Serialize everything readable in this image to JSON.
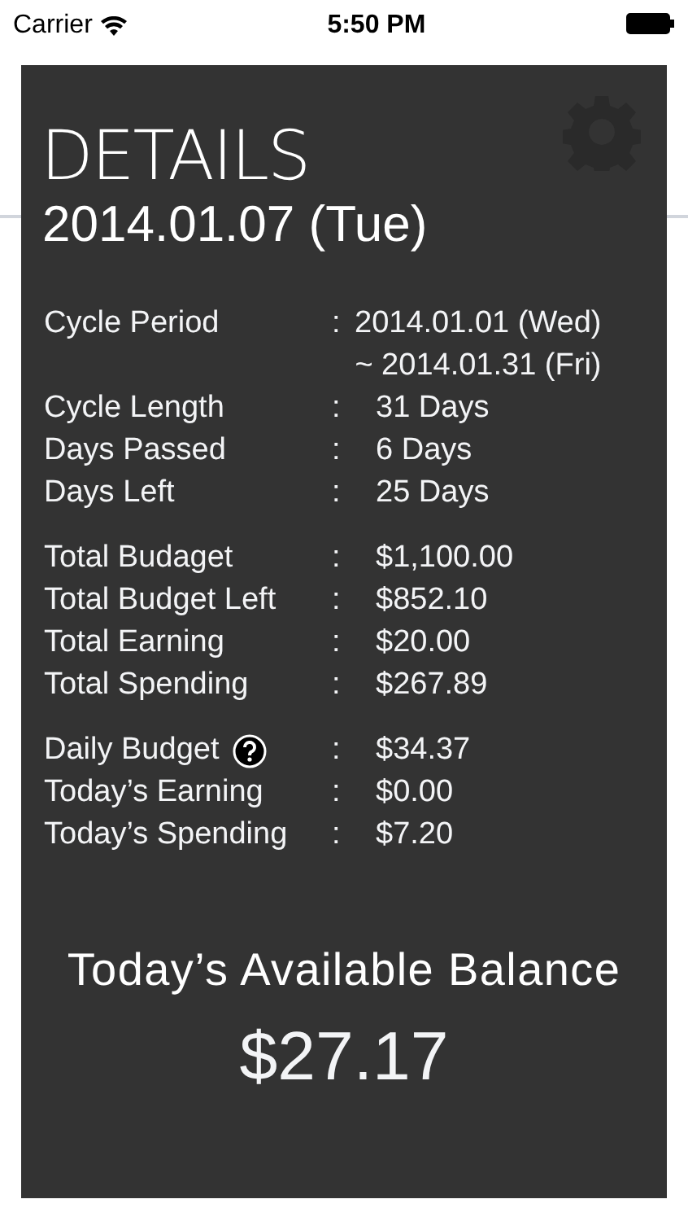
{
  "status_bar": {
    "carrier": "Carrier",
    "time": "5:50 PM"
  },
  "details": {
    "title": "DETAILS",
    "date": "2014.01.07 (Tue)",
    "groups": [
      [
        {
          "label": "Cycle Period",
          "separator": ":",
          "lines": [
            "2014.01.01 (Wed)",
            "~ 2014.01.31 (Fri)"
          ]
        },
        {
          "label": "Cycle Length",
          "separator": ":",
          "lines": [
            "31 Days"
          ]
        },
        {
          "label": "Days Passed",
          "separator": ":",
          "lines": [
            "6 Days"
          ]
        },
        {
          "label": "Days Left",
          "separator": ":",
          "lines": [
            "25 Days"
          ]
        }
      ],
      [
        {
          "label": "Total Budaget",
          "separator": ":",
          "lines": [
            "$1,100.00"
          ]
        },
        {
          "label": "Total Budget Left",
          "separator": ":",
          "lines": [
            "$852.10"
          ]
        },
        {
          "label": "Total Earning",
          "separator": ":",
          "lines": [
            "$20.00"
          ]
        },
        {
          "label": "Total Spending",
          "separator": ":",
          "lines": [
            "$267.89"
          ]
        }
      ],
      [
        {
          "label": "Daily Budget",
          "help": true,
          "separator": ":",
          "lines": [
            "$34.37"
          ]
        },
        {
          "label": "Today’s Earning",
          "separator": ":",
          "lines": [
            "$0.00"
          ]
        },
        {
          "label": "Today’s Spending",
          "separator": ":",
          "lines": [
            "$7.20"
          ]
        }
      ]
    ],
    "balance_label": "Today’s Available Balance",
    "balance": "$27.17"
  }
}
